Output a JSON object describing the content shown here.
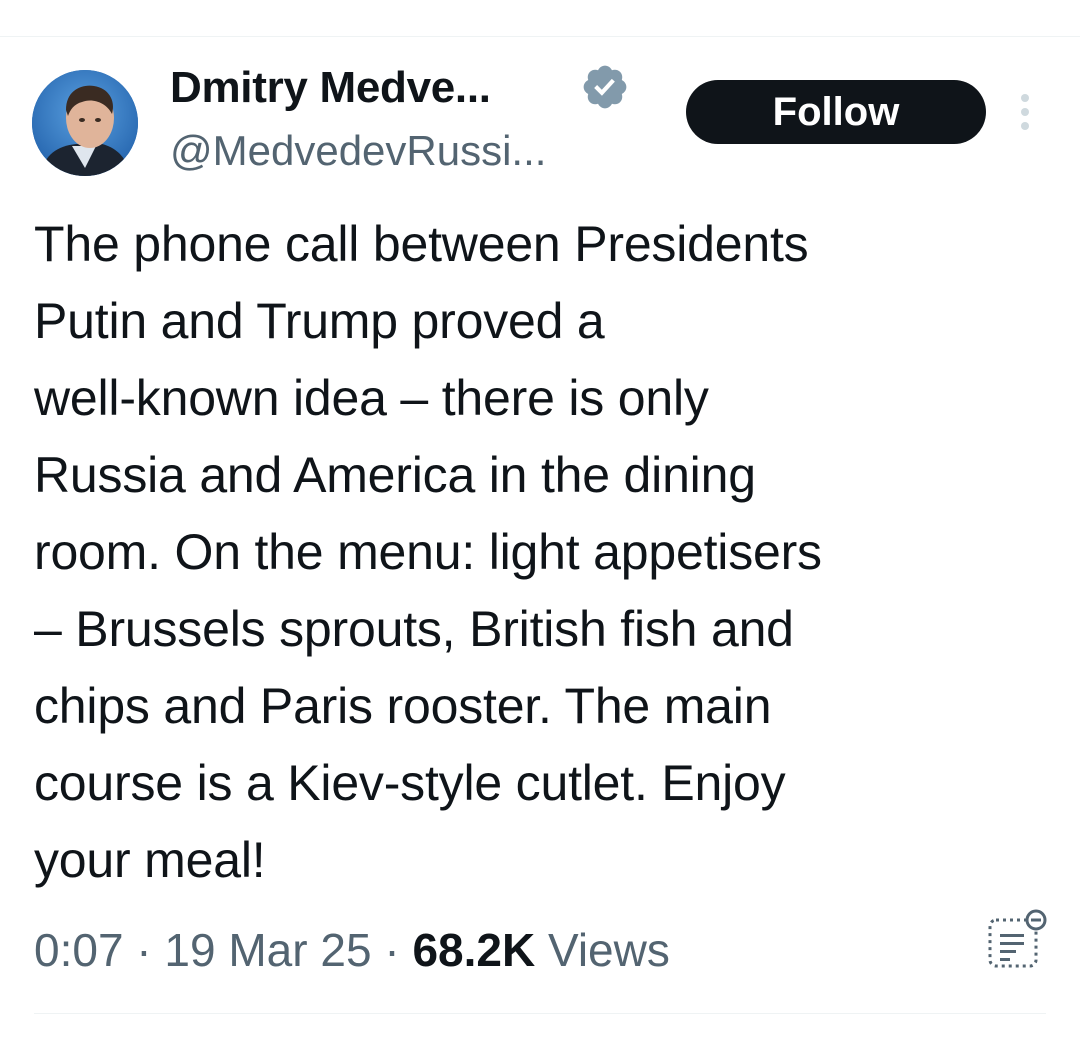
{
  "author": {
    "display_name": "Dmitry Medve...",
    "handle": "@MedvedevRussi..."
  },
  "follow_button": {
    "label": "Follow"
  },
  "tweet": {
    "text": "The phone call between Presidents\nPutin and Trump proved a\nwell-known idea – there is only\nRussia and America in the dining\nroom. On the menu: light appetisers\n– Brussels sprouts, British fish and\nchips and Paris rooster. The main\ncourse is a Kiev-style cutlet. Enjoy\nyour meal!"
  },
  "meta": {
    "time": "0:07",
    "separator": " · ",
    "date": "19 Mar 25",
    "views_count": "68.2K",
    "views_label": " Views"
  },
  "icons": {
    "verified": "verified-badge-icon",
    "more": "more-options-icon",
    "analytics": "analytics-icon"
  },
  "colors": {
    "text_primary": "#0f1419",
    "text_secondary": "#536471",
    "follow_bg": "#0f1419",
    "divider": "#eff3f4"
  }
}
